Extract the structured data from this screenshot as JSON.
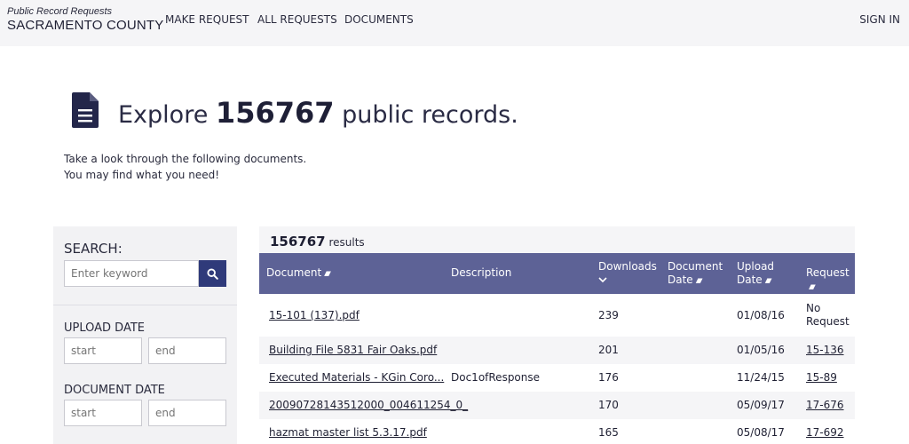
{
  "header": {
    "brand_sub": "Public Record Requests",
    "brand_main": "SACRAMENTO COUNTY",
    "nav": {
      "make_request": "MAKE REQUEST",
      "all_requests": "ALL REQUESTS",
      "documents": "DOCUMENTS",
      "sign_in": "SIGN IN"
    }
  },
  "hero": {
    "title_prefix": "Explore",
    "record_count": "156767",
    "title_suffix": "public records.",
    "subtitle_line1": "Take a look through the following documents.",
    "subtitle_line2": "You may find what you need!"
  },
  "sidebar": {
    "search_label": "SEARCH:",
    "search_placeholder": "Enter keyword",
    "upload_date_label": "UPLOAD DATE",
    "document_date_label": "DOCUMENT DATE",
    "start_placeholder": "start",
    "end_placeholder": "end"
  },
  "results": {
    "count": "156767",
    "count_suffix": "results",
    "columns": {
      "document": "Document",
      "description": "Description",
      "downloads": "Downloads",
      "document_date_1": "Document",
      "document_date_2": "Date",
      "upload_date_1": "Upload",
      "upload_date_2": "Date",
      "request": "Request"
    },
    "rows": [
      {
        "document": "15-101 (137).pdf",
        "description": "",
        "downloads": "239",
        "document_date": "",
        "upload_date": "01/08/16",
        "request_1": "No",
        "request_2": "Request"
      },
      {
        "document": "Building File 5831 Fair Oaks.pdf",
        "description": "",
        "downloads": "201",
        "document_date": "",
        "upload_date": "01/05/16",
        "request_1": "15-136",
        "request_2": ""
      },
      {
        "document": "Executed Materials - KGin Coro...",
        "description": "Doc1ofResponse",
        "downloads": "176",
        "document_date": "",
        "upload_date": "11/24/15",
        "request_1": "15-89",
        "request_2": ""
      },
      {
        "document": "20090728143512000_004611254_0_",
        "description": "",
        "downloads": "170",
        "document_date": "",
        "upload_date": "05/09/17",
        "request_1": "17-676",
        "request_2": ""
      },
      {
        "document": "hazmat master list 5.3.17.pdf",
        "description": "",
        "downloads": "165",
        "document_date": "",
        "upload_date": "05/08/17",
        "request_1": "17-692",
        "request_2": ""
      }
    ]
  },
  "colors": {
    "table_header": "#5d6296",
    "search_button": "#2f3a7a",
    "header_bg": "#f5f5f7",
    "doc_icon": "#23264a"
  },
  "icons": {
    "hero": "document-icon",
    "search": "search-icon",
    "sort": "sort-icon",
    "sort_desc": "chevron-down-icon"
  }
}
